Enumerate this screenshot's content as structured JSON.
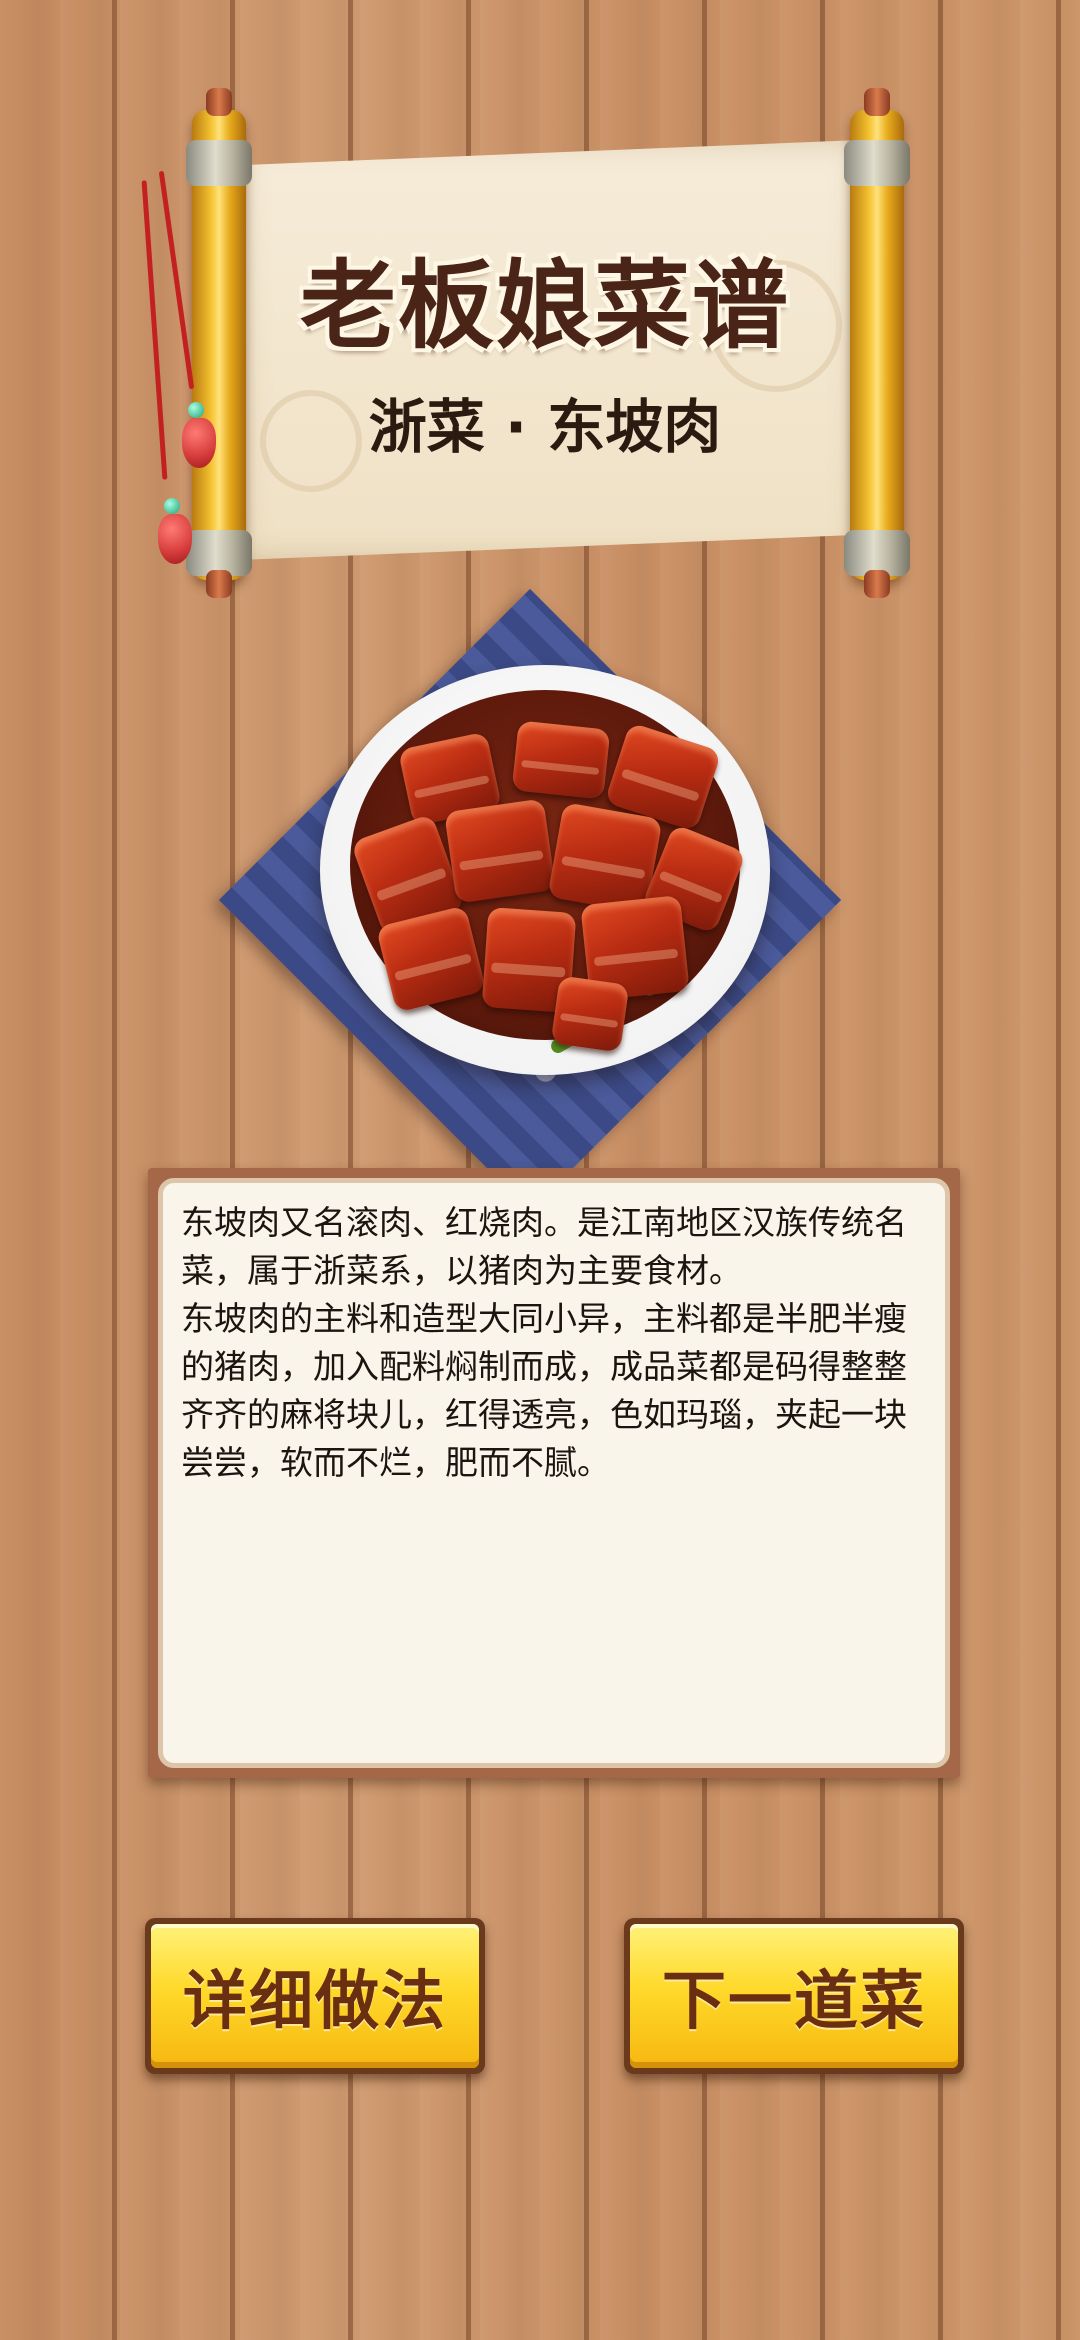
{
  "header": {
    "title": "老板娘菜谱",
    "subtitle": "浙菜 · 东坡肉"
  },
  "dish": {
    "image_icon": "dongpo-pork-dish-illustration"
  },
  "description": {
    "text": "东坡肉又名滚肉、红烧肉。是江南地区汉族传统名菜，属于浙菜系，以猪肉为主要食材。\n东坡肉的主料和造型大同小异，主料都是半肥半瘦的猪肉，加入配料焖制而成，成品菜都是码得整整齐齐的麻将块儿，红得透亮，色如玛瑙，夹起一块尝尝，软而不烂，肥而不腻。"
  },
  "buttons": {
    "details_label": "详细做法",
    "next_label": "下一道菜"
  },
  "colors": {
    "button_fill": "#ffd92b",
    "button_text": "#6a2e10",
    "title_text": "#4a2416",
    "wood": "#c88e63"
  }
}
